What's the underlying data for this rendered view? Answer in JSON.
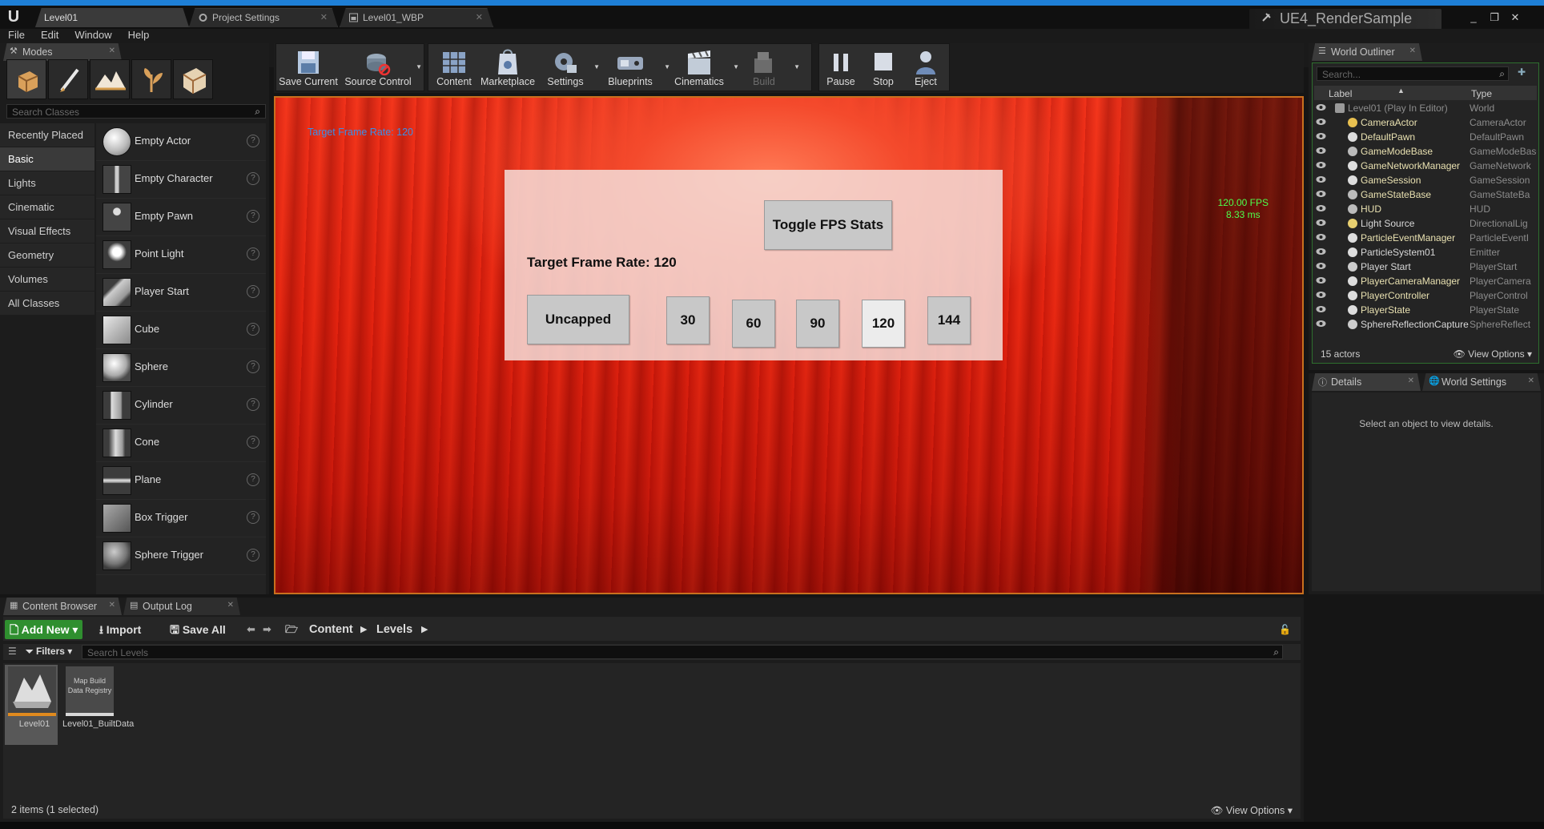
{
  "app": {
    "doc_tabs": [
      {
        "label": "Level01"
      },
      {
        "label": "Project Settings"
      },
      {
        "label": "Level01_WBP"
      }
    ],
    "project_name": "UE4_RenderSample",
    "window_buttons": [
      "_",
      "❐",
      "✕"
    ]
  },
  "menu": {
    "items": [
      "File",
      "Edit",
      "Window",
      "Help"
    ]
  },
  "modes": {
    "tab_label": "Modes",
    "search_placeholder": "Search Classes",
    "categories": [
      "Recently Placed",
      "Basic",
      "Lights",
      "Cinematic",
      "Visual Effects",
      "Geometry",
      "Volumes",
      "All Classes"
    ],
    "active_category": "Basic",
    "items": [
      "Empty Actor",
      "Empty Character",
      "Empty Pawn",
      "Point Light",
      "Player Start",
      "Cube",
      "Sphere",
      "Cylinder",
      "Cone",
      "Plane",
      "Box Trigger",
      "Sphere Trigger"
    ]
  },
  "toolbar": {
    "save_current": "Save Current",
    "source_control": "Source Control",
    "content": "Content",
    "marketplace": "Marketplace",
    "settings": "Settings",
    "blueprints": "Blueprints",
    "cinematics": "Cinematics",
    "build": "Build",
    "pause": "Pause",
    "stop": "Stop",
    "eject": "Eject"
  },
  "viewport": {
    "overlay_rate": "Target Frame Rate: 120",
    "fps_line1": "120.00 FPS",
    "fps_line2": "8.33 ms",
    "widget": {
      "toggle_label": "Toggle FPS Stats",
      "rate_text": "Target Frame Rate: 120",
      "uncapped_label": "Uncapped",
      "rate_buttons": [
        "30",
        "60",
        "90",
        "120",
        "144"
      ],
      "hovered_button": "120"
    }
  },
  "outliner": {
    "tab_label": "World Outliner",
    "search_placeholder": "Search...",
    "col_label": "Label",
    "col_type": "Type",
    "rows": [
      {
        "label": "Level01 (Play In Editor)",
        "type": "World"
      },
      {
        "label": "CameraActor",
        "type": "CameraActor"
      },
      {
        "label": "DefaultPawn",
        "type": "DefaultPawn"
      },
      {
        "label": "GameModeBase",
        "type": "GameModeBase"
      },
      {
        "label": "GameNetworkManager",
        "type": "GameNetwork"
      },
      {
        "label": "GameSession",
        "type": "GameSession"
      },
      {
        "label": "GameStateBase",
        "type": "GameStateBa"
      },
      {
        "label": "HUD",
        "type": "HUD"
      },
      {
        "label": "Light Source",
        "type": "DirectionalLig"
      },
      {
        "label": "ParticleEventManager",
        "type": "ParticleEventI"
      },
      {
        "label": "ParticleSystem01",
        "type": "Emitter"
      },
      {
        "label": "Player Start",
        "type": "PlayerStart"
      },
      {
        "label": "PlayerCameraManager",
        "type": "PlayerCamera"
      },
      {
        "label": "PlayerController",
        "type": "PlayerControl"
      },
      {
        "label": "PlayerState",
        "type": "PlayerState"
      },
      {
        "label": "SphereReflectionCapture",
        "type": "SphereReflect"
      }
    ],
    "count": "15 actors",
    "view_options": "View Options"
  },
  "details": {
    "tab_label": "Details",
    "world_settings_label": "World Settings",
    "empty_message": "Select an object to view details."
  },
  "content_browser": {
    "tab_label": "Content Browser",
    "output_log_label": "Output Log",
    "add_new": "Add New",
    "import": "Import",
    "save_all": "Save All",
    "breadcrumbs": [
      "Content",
      "Levels"
    ],
    "filters": "Filters",
    "search_placeholder": "Search Levels",
    "assets": [
      {
        "name": "Level01"
      },
      {
        "name": "Level01_BuiltData",
        "thumb_text": "Map Build Data Registry"
      }
    ],
    "status": "2 items (1 selected)",
    "view_options": "View Options"
  },
  "colors": {
    "accent_blue": "#1e7fd6",
    "viewport_border": "#c9701e",
    "fps_green": "#4cff4c",
    "add_new_green": "#2f8f2f",
    "level_asset_bar": "#e08a1e",
    "builtdata_asset_bar": "#d8d8d8"
  }
}
